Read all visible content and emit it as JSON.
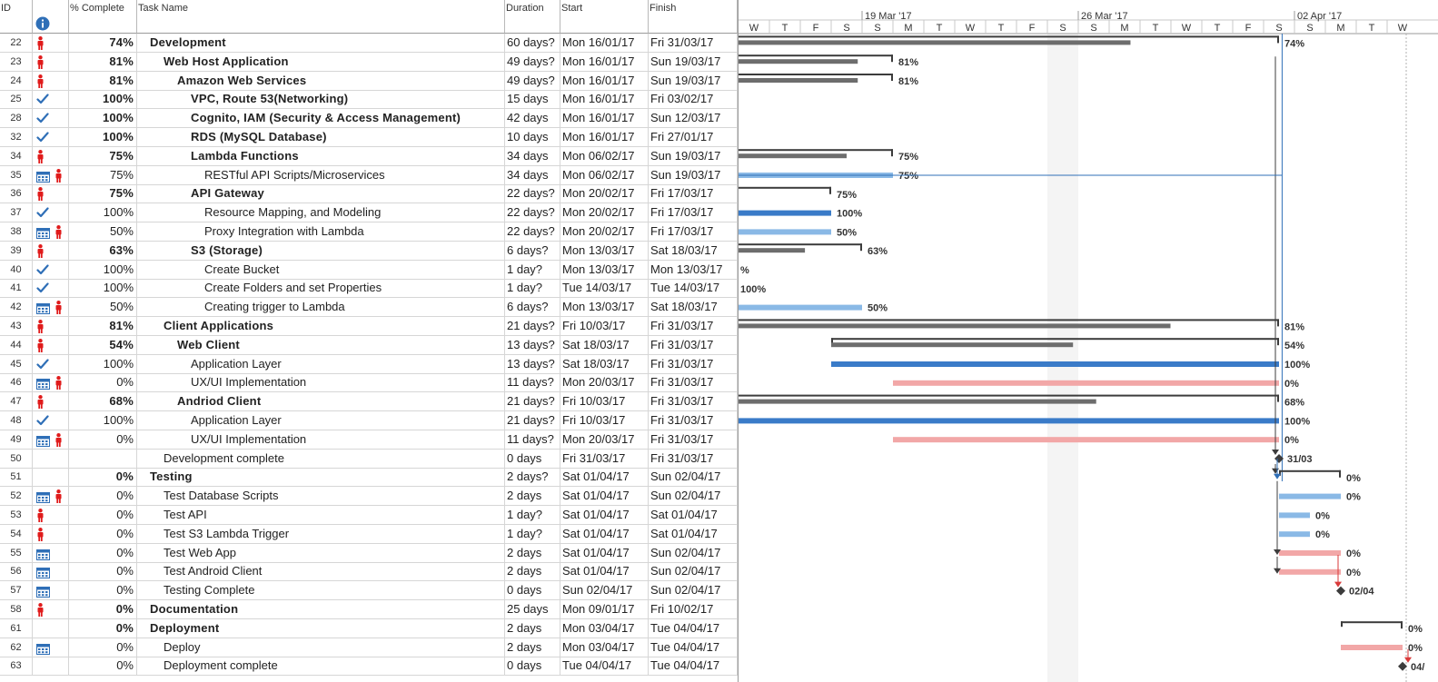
{
  "headers": {
    "id": "ID",
    "pct": "% Complete",
    "name": "Task Name",
    "dur": "Duration",
    "start": "Start",
    "finish": "Finish"
  },
  "timescale": {
    "weeks": [
      "19 Mar '17",
      "26 Mar '17",
      "02 Apr '17"
    ],
    "days": [
      "W",
      "T",
      "F",
      "S",
      "S",
      "M",
      "T",
      "W",
      "T",
      "F",
      "S",
      "S",
      "M",
      "T",
      "W",
      "T",
      "F",
      "S",
      "S",
      "M",
      "T",
      "W"
    ]
  },
  "colors": {
    "summary": "#6d6d6d",
    "complete": "#3a7bc8",
    "partial": "#8ab9e6",
    "notstarted": "#f2a7a7",
    "milestone": "#3c3c3c",
    "critical": "#d93a3a"
  },
  "tasks": [
    {
      "id": "22",
      "ind": [
        "person"
      ],
      "pct": "74%",
      "name": "Development",
      "level": 0,
      "summary": true,
      "dur": "60 days?",
      "start": "Mon 16/01/17",
      "finish": "Fri 31/03/17",
      "bar": {
        "type": "summary",
        "from": -1,
        "to": 17.5,
        "done": "74%",
        "label": "74%"
      }
    },
    {
      "id": "23",
      "ind": [
        "person"
      ],
      "pct": "81%",
      "name": "Web Host Application",
      "level": 1,
      "summary": true,
      "dur": "49 days?",
      "start": "Mon 16/01/17",
      "finish": "Sun 19/03/17",
      "bar": {
        "type": "summary",
        "from": -1,
        "to": 5,
        "done": "81%",
        "label": "81%"
      }
    },
    {
      "id": "24",
      "ind": [
        "person"
      ],
      "pct": "81%",
      "name": "Amazon Web Services",
      "level": 2,
      "summary": true,
      "dur": "49 days?",
      "start": "Mon 16/01/17",
      "finish": "Sun 19/03/17",
      "bar": {
        "type": "summary",
        "from": -1,
        "to": 5,
        "done": "81%",
        "label": "81%"
      }
    },
    {
      "id": "25",
      "ind": [
        "check"
      ],
      "pct": "100%",
      "name": "VPC, Route 53(Networking)",
      "level": 3,
      "summary": true,
      "dur": "15 days",
      "start": "Mon 16/01/17",
      "finish": "Fri 03/02/17",
      "bar": null
    },
    {
      "id": "28",
      "ind": [
        "check"
      ],
      "pct": "100%",
      "name": "Cognito, IAM (Security & Access Management)",
      "level": 3,
      "summary": true,
      "dur": "42 days",
      "start": "Mon 16/01/17",
      "finish": "Sun 12/03/17",
      "bar": null
    },
    {
      "id": "32",
      "ind": [
        "check"
      ],
      "pct": "100%",
      "name": "RDS (MySQL Database)",
      "level": 3,
      "summary": true,
      "dur": "10 days",
      "start": "Mon 16/01/17",
      "finish": "Fri 27/01/17",
      "bar": null
    },
    {
      "id": "34",
      "ind": [
        "person"
      ],
      "pct": "75%",
      "name": "Lambda Functions",
      "level": 3,
      "summary": true,
      "dur": "34 days",
      "start": "Mon 06/02/17",
      "finish": "Sun 19/03/17",
      "bar": {
        "type": "summary",
        "from": -1,
        "to": 5,
        "done": "75%",
        "label": "75%"
      }
    },
    {
      "id": "35",
      "ind": [
        "cal",
        "person"
      ],
      "pct": "75%",
      "name": "RESTful API Scripts/Microservices",
      "level": 4,
      "summary": false,
      "dur": "34 days",
      "start": "Mon 06/02/17",
      "finish": "Sun 19/03/17",
      "bar": {
        "type": "partial",
        "from": -1,
        "to": 5,
        "label": "75%"
      }
    },
    {
      "id": "36",
      "ind": [
        "person"
      ],
      "pct": "75%",
      "name": "API Gateway",
      "level": 3,
      "summary": true,
      "dur": "22 days?",
      "start": "Mon 20/02/17",
      "finish": "Fri 17/03/17",
      "bar": {
        "type": "summary",
        "from": -1,
        "to": 3,
        "done": "0%",
        "label": "75%"
      }
    },
    {
      "id": "37",
      "ind": [
        "check"
      ],
      "pct": "100%",
      "name": "Resource Mapping, and Modeling",
      "level": 4,
      "summary": false,
      "dur": "22 days?",
      "start": "Mon 20/02/17",
      "finish": "Fri 17/03/17",
      "bar": {
        "type": "complete",
        "from": -1,
        "to": 3,
        "label": "100%"
      }
    },
    {
      "id": "38",
      "ind": [
        "cal",
        "person"
      ],
      "pct": "50%",
      "name": "Proxy Integration with Lambda",
      "level": 4,
      "summary": false,
      "dur": "22 days?",
      "start": "Mon 20/02/17",
      "finish": "Fri 17/03/17",
      "bar": {
        "type": "partial",
        "from": -1,
        "to": 3,
        "label": "50%"
      }
    },
    {
      "id": "39",
      "ind": [
        "person"
      ],
      "pct": "63%",
      "name": "S3 (Storage)",
      "level": 3,
      "summary": true,
      "dur": "6 days?",
      "start": "Mon 13/03/17",
      "finish": "Sat 18/03/17",
      "bar": {
        "type": "summary",
        "from": -1,
        "to": 4,
        "done": "63%",
        "label": "63%"
      }
    },
    {
      "id": "40",
      "ind": [
        "check"
      ],
      "pct": "100%",
      "name": "Create Bucket",
      "level": 4,
      "summary": false,
      "dur": "1 day?",
      "start": "Mon 13/03/17",
      "finish": "Mon 13/03/17",
      "bar": {
        "type": "label",
        "from": -1,
        "to": -1,
        "label": "%"
      }
    },
    {
      "id": "41",
      "ind": [
        "check"
      ],
      "pct": "100%",
      "name": "Create Folders and set Properties",
      "level": 4,
      "summary": false,
      "dur": "1 day?",
      "start": "Tue 14/03/17",
      "finish": "Tue 14/03/17",
      "bar": {
        "type": "label",
        "from": -1,
        "to": -1,
        "label": "100%"
      }
    },
    {
      "id": "42",
      "ind": [
        "cal",
        "person"
      ],
      "pct": "50%",
      "name": "Creating trigger to Lambda",
      "level": 4,
      "summary": false,
      "dur": "6 days?",
      "start": "Mon 13/03/17",
      "finish": "Sat 18/03/17",
      "bar": {
        "type": "partial",
        "from": -1,
        "to": 4,
        "label": "50%"
      }
    },
    {
      "id": "43",
      "ind": [
        "person"
      ],
      "pct": "81%",
      "name": "Client Applications",
      "level": 1,
      "summary": true,
      "dur": "21 days?",
      "start": "Fri 10/03/17",
      "finish": "Fri 31/03/17",
      "bar": {
        "type": "summary",
        "from": -1,
        "to": 17.5,
        "done": "81%",
        "label": "81%"
      }
    },
    {
      "id": "44",
      "ind": [
        "person"
      ],
      "pct": "54%",
      "name": "Web Client",
      "level": 2,
      "summary": true,
      "dur": "13 days?",
      "start": "Sat 18/03/17",
      "finish": "Fri 31/03/17",
      "bar": {
        "type": "summary",
        "from": 3,
        "to": 17.5,
        "done": "54%",
        "label": "54%"
      }
    },
    {
      "id": "45",
      "ind": [
        "check"
      ],
      "pct": "100%",
      "name": "Application Layer",
      "level": 3,
      "summary": false,
      "dur": "13 days?",
      "start": "Sat 18/03/17",
      "finish": "Fri 31/03/17",
      "bar": {
        "type": "complete",
        "from": 3,
        "to": 17.5,
        "label": "100%"
      }
    },
    {
      "id": "46",
      "ind": [
        "cal",
        "person"
      ],
      "pct": "0%",
      "name": "UX/UI Implementation",
      "level": 3,
      "summary": false,
      "dur": "11 days?",
      "start": "Mon 20/03/17",
      "finish": "Fri 31/03/17",
      "bar": {
        "type": "notstarted",
        "from": 5,
        "to": 17.5,
        "label": "0%"
      }
    },
    {
      "id": "47",
      "ind": [
        "person"
      ],
      "pct": "68%",
      "name": "Andriod Client",
      "level": 2,
      "summary": true,
      "dur": "21 days?",
      "start": "Fri 10/03/17",
      "finish": "Fri 31/03/17",
      "bar": {
        "type": "summary",
        "from": -1,
        "to": 17.5,
        "done": "68%",
        "label": "68%"
      }
    },
    {
      "id": "48",
      "ind": [
        "check"
      ],
      "pct": "100%",
      "name": "Application Layer",
      "level": 3,
      "summary": false,
      "dur": "21 days?",
      "start": "Fri 10/03/17",
      "finish": "Fri 31/03/17",
      "bar": {
        "type": "complete",
        "from": -1,
        "to": 17.5,
        "label": "100%"
      }
    },
    {
      "id": "49",
      "ind": [
        "cal",
        "person"
      ],
      "pct": "0%",
      "name": "UX/UI Implementation",
      "level": 3,
      "summary": false,
      "dur": "11 days?",
      "start": "Mon 20/03/17",
      "finish": "Fri 31/03/17",
      "bar": {
        "type": "notstarted",
        "from": 5,
        "to": 17.5,
        "label": "0%"
      }
    },
    {
      "id": "50",
      "ind": [],
      "pct": "",
      "name": "Development complete",
      "level": 1,
      "summary": false,
      "dur": "0 days",
      "start": "Fri 31/03/17",
      "finish": "Fri 31/03/17",
      "bar": {
        "type": "milestone",
        "from": 17.5,
        "to": 17.5,
        "label": "31/03"
      }
    },
    {
      "id": "51",
      "ind": [],
      "pct": "0%",
      "name": "Testing",
      "level": 0,
      "summary": true,
      "dur": "2 days?",
      "start": "Sat 01/04/17",
      "finish": "Sun 02/04/17",
      "bar": {
        "type": "summary",
        "from": 17.5,
        "to": 19.5,
        "done": "0%",
        "label": "0%"
      }
    },
    {
      "id": "52",
      "ind": [
        "cal",
        "person"
      ],
      "pct": "0%",
      "name": "Test Database Scripts",
      "level": 1,
      "summary": false,
      "dur": "2 days",
      "start": "Sat 01/04/17",
      "finish": "Sun 02/04/17",
      "bar": {
        "type": "partial",
        "from": 17.5,
        "to": 19.5,
        "label": "0%"
      }
    },
    {
      "id": "53",
      "ind": [
        "person"
      ],
      "pct": "0%",
      "name": "Test API",
      "level": 1,
      "summary": false,
      "dur": "1 day?",
      "start": "Sat 01/04/17",
      "finish": "Sat 01/04/17",
      "bar": {
        "type": "partial",
        "from": 17.5,
        "to": 18.5,
        "label": "0%"
      }
    },
    {
      "id": "54",
      "ind": [
        "person"
      ],
      "pct": "0%",
      "name": "Test S3 Lambda Trigger",
      "level": 1,
      "summary": false,
      "dur": "1 day?",
      "start": "Sat 01/04/17",
      "finish": "Sat 01/04/17",
      "bar": {
        "type": "partial",
        "from": 17.5,
        "to": 18.5,
        "label": "0%"
      }
    },
    {
      "id": "55",
      "ind": [
        "cal"
      ],
      "pct": "0%",
      "name": "Test Web App",
      "level": 1,
      "summary": false,
      "dur": "2 days",
      "start": "Sat 01/04/17",
      "finish": "Sun 02/04/17",
      "bar": {
        "type": "notstarted",
        "from": 17.5,
        "to": 19.5,
        "label": "0%"
      }
    },
    {
      "id": "56",
      "ind": [
        "cal"
      ],
      "pct": "0%",
      "name": "Test Android Client",
      "level": 1,
      "summary": false,
      "dur": "2 days",
      "start": "Sat 01/04/17",
      "finish": "Sun 02/04/17",
      "bar": {
        "type": "notstarted",
        "from": 17.5,
        "to": 19.5,
        "label": "0%"
      }
    },
    {
      "id": "57",
      "ind": [
        "cal"
      ],
      "pct": "0%",
      "name": "Testing Complete",
      "level": 1,
      "summary": false,
      "dur": "0 days",
      "start": "Sun 02/04/17",
      "finish": "Sun 02/04/17",
      "bar": {
        "type": "milestone",
        "from": 19.5,
        "to": 19.5,
        "label": "02/04"
      }
    },
    {
      "id": "58",
      "ind": [
        "person"
      ],
      "pct": "0%",
      "name": "Documentation",
      "level": 0,
      "summary": true,
      "dur": "25 days",
      "start": "Mon 09/01/17",
      "finish": "Fri 10/02/17",
      "bar": null
    },
    {
      "id": "61",
      "ind": [],
      "pct": "0%",
      "name": "Deployment",
      "level": 0,
      "summary": true,
      "dur": "2 days",
      "start": "Mon 03/04/17",
      "finish": "Tue 04/04/17",
      "bar": {
        "type": "summary",
        "from": 19.5,
        "to": 21.5,
        "done": "0%",
        "label": "0%"
      }
    },
    {
      "id": "62",
      "ind": [
        "cal"
      ],
      "pct": "0%",
      "name": "Deploy",
      "level": 1,
      "summary": false,
      "dur": "2 days",
      "start": "Mon 03/04/17",
      "finish": "Tue 04/04/17",
      "bar": {
        "type": "notstarted",
        "from": 19.5,
        "to": 21.5,
        "label": "0%"
      }
    },
    {
      "id": "63",
      "ind": [],
      "pct": "0%",
      "name": "Deployment complete",
      "level": 1,
      "summary": false,
      "dur": "0 days",
      "start": "Tue 04/04/17",
      "finish": "Tue 04/04/17",
      "bar": {
        "type": "milestone",
        "from": 21.5,
        "to": 21.5,
        "label": "04/"
      }
    }
  ]
}
